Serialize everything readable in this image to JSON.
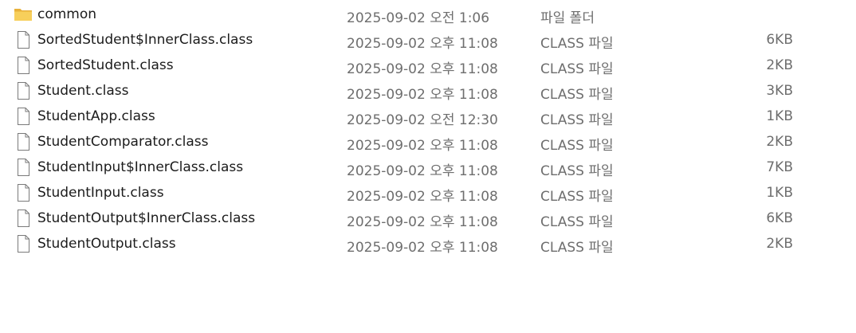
{
  "files": [
    {
      "name": "common",
      "date": "2025-09-02 오전 1:06",
      "type": "파일 폴더",
      "size": "",
      "icon": "folder-icon",
      "icon_color": "#f2c14e"
    },
    {
      "name": "SortedStudent$InnerClass.class",
      "date": "2025-09-02 오후 11:08",
      "type": "CLASS 파일",
      "size": "6KB",
      "icon": "file-icon"
    },
    {
      "name": "SortedStudent.class",
      "date": "2025-09-02 오후 11:08",
      "type": "CLASS 파일",
      "size": "2KB",
      "icon": "file-icon"
    },
    {
      "name": "Student.class",
      "date": "2025-09-02 오후 11:08",
      "type": "CLASS 파일",
      "size": "3KB",
      "icon": "file-icon"
    },
    {
      "name": "StudentApp.class",
      "date": "2025-09-02 오전 12:30",
      "type": "CLASS 파일",
      "size": "1KB",
      "icon": "file-icon"
    },
    {
      "name": "StudentComparator.class",
      "date": "2025-09-02 오후 11:08",
      "type": "CLASS 파일",
      "size": "2KB",
      "icon": "file-icon"
    },
    {
      "name": "StudentInput$InnerClass.class",
      "date": "2025-09-02 오후 11:08",
      "type": "CLASS 파일",
      "size": "7KB",
      "icon": "file-icon"
    },
    {
      "name": "StudentInput.class",
      "date": "2025-09-02 오후 11:08",
      "type": "CLASS 파일",
      "size": "1KB",
      "icon": "file-icon"
    },
    {
      "name": "StudentOutput$InnerClass.class",
      "date": "2025-09-02 오후 11:08",
      "type": "CLASS 파일",
      "size": "6KB",
      "icon": "file-icon"
    },
    {
      "name": "StudentOutput.class",
      "date": "2025-09-02 오후 11:08",
      "type": "CLASS 파일",
      "size": "2KB",
      "icon": "file-icon"
    }
  ]
}
